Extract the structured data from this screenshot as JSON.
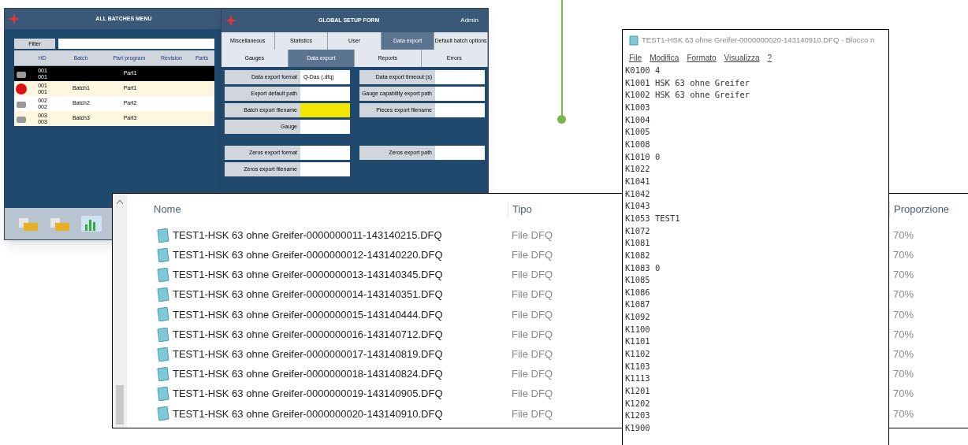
{
  "batches_window": {
    "title": "ALL BATCHES MENU",
    "filter_label": "Filter",
    "columns": [
      "HD",
      "Batch",
      "Part program",
      "Revision",
      "Parts"
    ],
    "rows": [
      {
        "hd": "001\n001",
        "part": "Part1",
        "selected": true,
        "kind": "machine"
      },
      {
        "hd": "001\n001",
        "batch": "Batch1",
        "part": "Part1",
        "selected": false,
        "kind": "stop"
      },
      {
        "hd": "002\n002",
        "batch": "Batch2",
        "part": "Part2",
        "selected": false,
        "kind": "machine"
      },
      {
        "hd": "003\n003",
        "batch": "Batch3",
        "part": "Part3",
        "selected": false,
        "kind": "machine"
      }
    ]
  },
  "setup_window": {
    "title": "GLOBAL SETUP FORM",
    "user": "Admin",
    "tabs_top": [
      {
        "label": "Miscellaneous",
        "selected": false
      },
      {
        "label": "Statistics",
        "selected": false
      },
      {
        "label": "User",
        "selected": false
      },
      {
        "label": "Data export",
        "selected": true
      },
      {
        "label": "Default batch options",
        "selected": false
      }
    ],
    "tabs_bottom": [
      {
        "label": "Gauges",
        "selected": false
      },
      {
        "label": "Data export",
        "selected": true
      },
      {
        "label": "Reports",
        "selected": false
      },
      {
        "label": "Errors",
        "selected": false
      }
    ],
    "fields_left": [
      {
        "label": "Data export format",
        "value": "Q-Das (.dfq)",
        "highlighted": false
      },
      {
        "label": "Export default path",
        "highlighted": false
      },
      {
        "label": "Batch export filename",
        "highlighted": true
      },
      {
        "label": "Gauge",
        "highlighted": false
      }
    ],
    "fields_right": [
      {
        "label": "Data export timeout (s)",
        "highlighted": false
      },
      {
        "label": "Gauge capability export path",
        "highlighted": false
      },
      {
        "label": "Pieces export filename",
        "highlighted": false
      }
    ],
    "zeros_left": [
      {
        "label": "Zeros export format",
        "highlighted": false
      },
      {
        "label": "Zeros export filename",
        "highlighted": false
      }
    ],
    "zeros_right": [
      {
        "label": "Zeros export path",
        "highlighted": false
      }
    ]
  },
  "explorer": {
    "columns": [
      "Nome",
      "Tipo",
      null,
      "Proporzione"
    ],
    "rows": [
      {
        "name": "TEST1-HSK 63 ohne Greifer-0000000011-143140215.DFQ",
        "type": "File DFQ",
        "ratio": "70%"
      },
      {
        "name": "TEST1-HSK 63 ohne Greifer-0000000012-143140220.DFQ",
        "type": "File DFQ",
        "ratio": "70%"
      },
      {
        "name": "TEST1-HSK 63 ohne Greifer-0000000013-143140345.DFQ",
        "type": "File DFQ",
        "ratio": "70%"
      },
      {
        "name": "TEST1-HSK 63 ohne Greifer-0000000014-143140351.DFQ",
        "type": "File DFQ",
        "ratio": "70%"
      },
      {
        "name": "TEST1-HSK 63 ohne Greifer-0000000015-143140444.DFQ",
        "type": "File DFQ",
        "ratio": "70%"
      },
      {
        "name": "TEST1-HSK 63 ohne Greifer-0000000016-143140712.DFQ",
        "type": "File DFQ",
        "ratio": "70%"
      },
      {
        "name": "TEST1-HSK 63 ohne Greifer-0000000017-143140819.DFQ",
        "type": "File DFQ",
        "ratio": "70%"
      },
      {
        "name": "TEST1-HSK 63 ohne Greifer-0000000018-143140824.DFQ",
        "type": "File DFQ",
        "ratio": "70%"
      },
      {
        "name": "TEST1-HSK 63 ohne Greifer-0000000019-143140905.DFQ",
        "type": "File DFQ",
        "ratio": "70%"
      },
      {
        "name": "TEST1-HSK 63 ohne Greifer-0000000020-143140910.DFQ",
        "type": "File DFQ",
        "ratio": "70%"
      }
    ]
  },
  "notepad": {
    "title": "TEST1-HSK 63 ohne Greifer-0000000020-143140910.DFQ - Blocco n",
    "menu": [
      "File",
      "Modifica",
      "Formato",
      "Visualizza",
      "?"
    ],
    "lines": [
      "K0100 4",
      "K1001 HSK 63 ohne Greifer",
      "K1002 HSK 63 ohne Greifer",
      "K1003",
      "K1004",
      "K1005",
      "K1008",
      "K1010 0",
      "K1022",
      "K1041",
      "K1042",
      "K1043",
      "K1053 TEST1",
      "K1072",
      "K1081",
      "K1082",
      "K1083 0",
      "K1085",
      "K1086",
      "K1087",
      "K1092",
      "K1100",
      "K1101",
      "K1102",
      "K1103",
      "K1113",
      "K1201",
      "K1202",
      "K1203",
      "K1900"
    ]
  }
}
